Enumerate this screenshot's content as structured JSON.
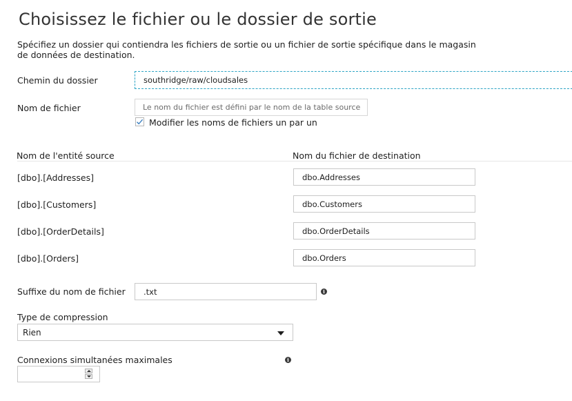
{
  "page": {
    "title": "Choisissez le fichier ou le dossier de sortie",
    "description": "Spécifiez un dossier qui contiendra les fichiers de sortie ou un fichier de sortie spécifique dans le magasin de données de destination."
  },
  "folder_path": {
    "label": "Chemin du dossier",
    "value": "southridge/raw/cloudsales"
  },
  "file_name": {
    "label": "Nom de fichier",
    "placeholder": "Le nom du fichier est défini par le nom de la table source",
    "modify_checkbox_label": "Modifier les noms de fichiers un par un",
    "modify_checked": true
  },
  "mapping": {
    "source_header": "Nom de l'entité source",
    "dest_header": "Nom du fichier de destination",
    "rows": [
      {
        "source": "[dbo].[Addresses]",
        "dest": "dbo.Addresses"
      },
      {
        "source": "[dbo].[Customers]",
        "dest": "dbo.Customers"
      },
      {
        "source": "[dbo].[OrderDetails]",
        "dest": "dbo.OrderDetails"
      },
      {
        "source": "[dbo].[Orders]",
        "dest": "dbo.Orders"
      }
    ]
  },
  "suffix": {
    "label": "Suffixe du nom de fichier",
    "value": ".txt",
    "info_icon": "info-icon"
  },
  "compression": {
    "label": "Type de compression",
    "selected": "Rien"
  },
  "max_connections": {
    "label": "Connexions simultanées maximales",
    "value": "",
    "info_icon": "info-icon"
  },
  "colors": {
    "focus_border": "#2aa3c4",
    "checkmark": "#3a7fbf"
  }
}
